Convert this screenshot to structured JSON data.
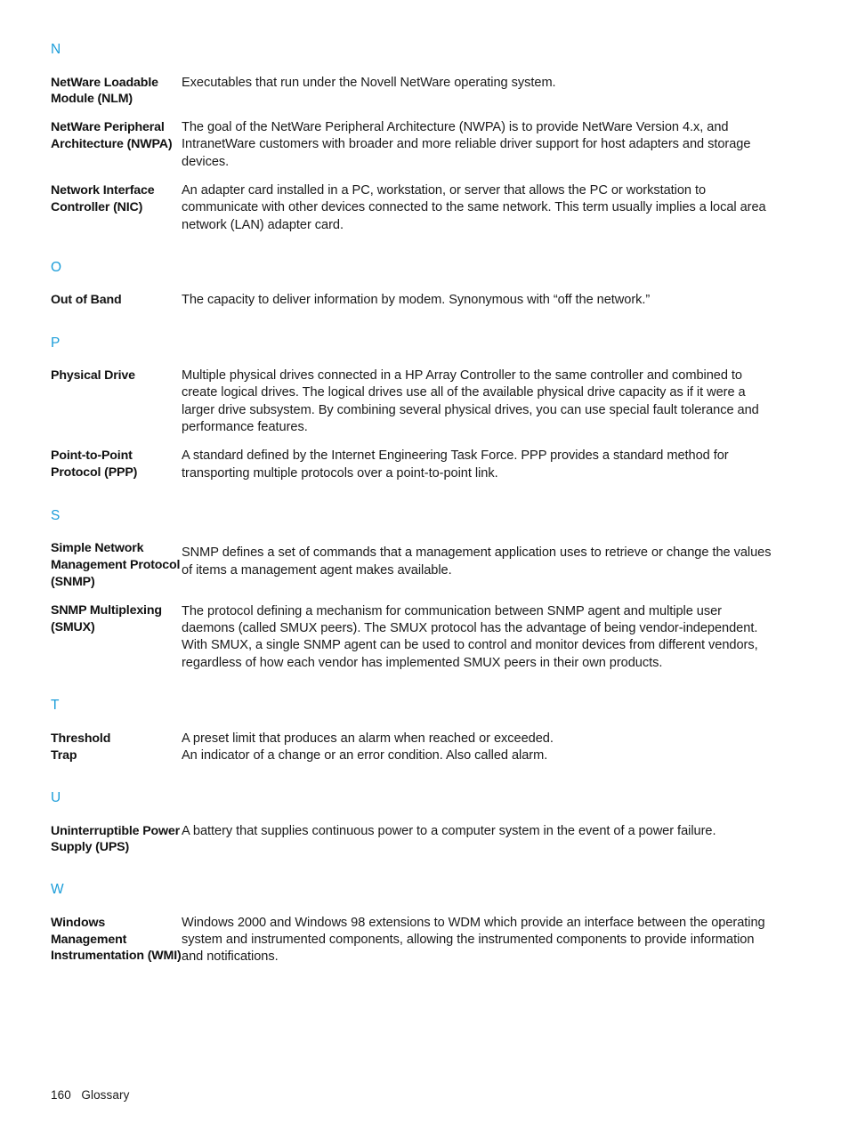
{
  "document": {
    "type": "glossary-page",
    "accent_color": "#1B9DD9",
    "text_color": "#1a1a1a",
    "background_color": "#ffffff"
  },
  "sections": [
    {
      "letter": "N",
      "entries": [
        {
          "term": "NetWare Loadable Module (NLM)",
          "definition": "Executables that run under the Novell NetWare operating system."
        },
        {
          "term": "NetWare Peripheral Architecture (NWPA)",
          "definition": "The goal of the NetWare Peripheral Architecture (NWPA) is to provide NetWare Version 4.x, and IntranetWare customers with broader and more reliable driver support for host adapters and storage devices."
        },
        {
          "term": "Network Interface Controller (NIC)",
          "definition": "An adapter card installed in a PC, workstation, or server that allows the PC or workstation to communicate with other devices connected to the same network. This term usually implies a local area network (LAN) adapter card."
        }
      ]
    },
    {
      "letter": "O",
      "entries": [
        {
          "term": "Out of Band",
          "definition": "The capacity to deliver information by modem. Synonymous with “off the network.”"
        }
      ]
    },
    {
      "letter": "P",
      "entries": [
        {
          "term": "Physical Drive",
          "definition": "Multiple physical drives connected in a HP Array Controller to the same controller and combined to create logical drives. The logical drives use all of the available physical drive capacity as if it were a larger drive subsystem. By combining several physical drives, you can use special fault tolerance and performance features."
        },
        {
          "term": "Point-to-Point Protocol (PPP)",
          "definition": "A standard defined by the Internet Engineering Task Force. PPP provides a standard method for transporting multiple protocols over a point-to-point link."
        }
      ]
    },
    {
      "letter": "S",
      "entries": [
        {
          "term": "Simple Network Management Protocol (SNMP)",
          "definition": "SNMP defines a set of commands that a management application uses to retrieve or change the values of items a management agent makes available."
        },
        {
          "term": "SNMP Multiplexing (SMUX)",
          "definition": "The protocol defining a mechanism for communication between SNMP agent and multiple user daemons (called SMUX peers). The SMUX protocol has the advantage of being vendor-independent. With SMUX, a single SNMP agent can be used to control and monitor devices from different vendors, regardless of how each vendor has implemented SMUX peers in their own products."
        }
      ]
    },
    {
      "letter": "T",
      "entries": [
        {
          "term": "Threshold",
          "definition": "A preset limit that produces an alarm when reached or exceeded."
        },
        {
          "term": "Trap",
          "definition": "An indicator of a change or an error condition. Also called alarm."
        }
      ]
    },
    {
      "letter": "U",
      "entries": [
        {
          "term": "Uninterruptible Power Supply (UPS)",
          "definition": "A battery that supplies continuous power to a computer system in the event of a power failure."
        }
      ]
    },
    {
      "letter": "W",
      "entries": [
        {
          "term": "Windows Management Instrumentation (WMI)",
          "definition": "Windows 2000 and Windows 98 extensions to WDM which provide an interface between the operating system and instrumented components, allowing the instrumented components to provide information and notifications."
        }
      ]
    }
  ],
  "footer": {
    "page_number": "160",
    "section_name": "Glossary",
    "text": "160   Glossary"
  }
}
